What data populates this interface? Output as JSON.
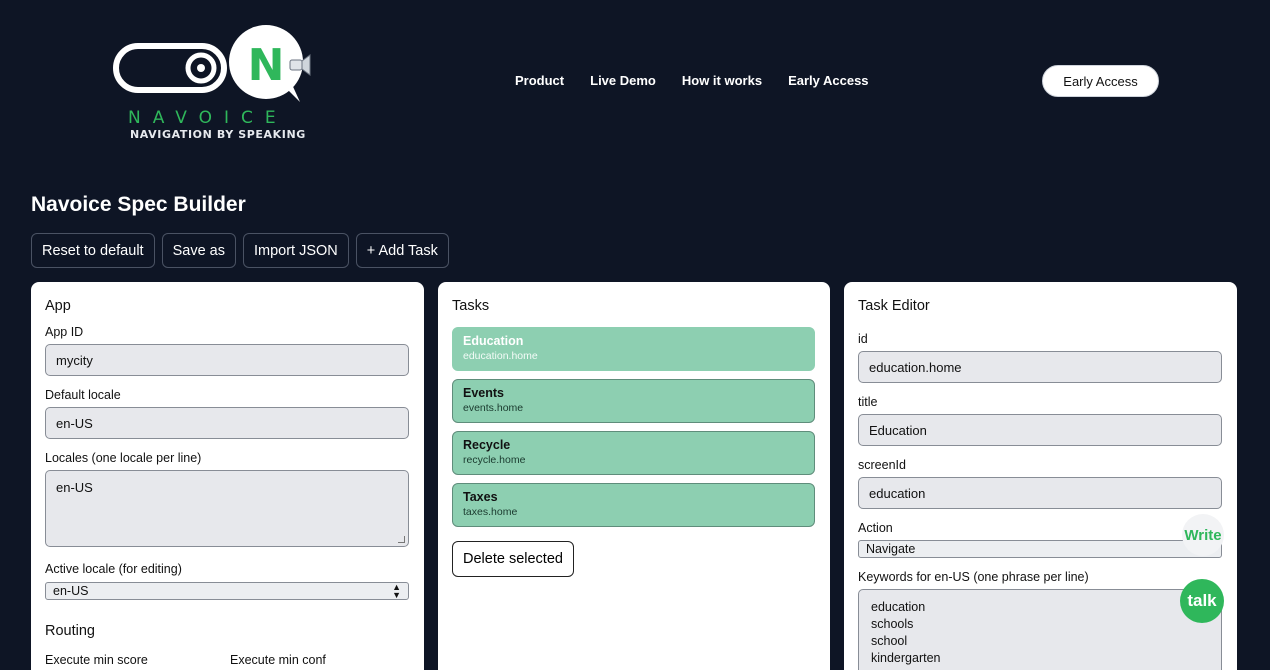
{
  "header": {
    "brand": "NAVOICE",
    "tagline": "NAVIGATION BY SPEAKING",
    "nav": [
      "Product",
      "Live Demo",
      "How it works",
      "Early Access"
    ],
    "cta": "Early Access"
  },
  "page": {
    "title": "Navoice Spec Builder",
    "toolbar": [
      "Reset to default",
      "Save as",
      "Import JSON",
      "+ Add Task"
    ]
  },
  "app_panel": {
    "title": "App",
    "app_id_label": "App ID",
    "app_id": "mycity",
    "default_locale_label": "Default locale",
    "default_locale": "en-US",
    "locales_label": "Locales (one locale per line)",
    "locales": "en-US",
    "active_locale_label": "Active locale (for editing)",
    "active_locale": "en-US",
    "routing_title": "Routing",
    "exec_min_score_label": "Execute min score",
    "exec_min_conf_label": "Execute min conf"
  },
  "tasks_panel": {
    "title": "Tasks",
    "tasks": [
      {
        "title": "Education",
        "id": "education.home",
        "selected": true
      },
      {
        "title": "Events",
        "id": "events.home",
        "selected": false
      },
      {
        "title": "Recycle",
        "id": "recycle.home",
        "selected": false
      },
      {
        "title": "Taxes",
        "id": "taxes.home",
        "selected": false
      }
    ],
    "delete_label": "Delete selected"
  },
  "editor_panel": {
    "title": "Task Editor",
    "id_label": "id",
    "id": "education.home",
    "title_label": "title",
    "title_value": "Education",
    "screen_label": "screenId",
    "screen_value": "education",
    "action_label": "Action",
    "action_value": "Navigate",
    "keywords_label": "Keywords for en-US (one phrase per line)",
    "keywords": [
      "education",
      "schools",
      "school",
      "kindergarten"
    ]
  },
  "badges": {
    "write": "Write",
    "talk": "talk"
  },
  "colors": {
    "background": "#0e1525",
    "accent_green": "#2fb75b",
    "task_green": "#8dcfb1"
  }
}
